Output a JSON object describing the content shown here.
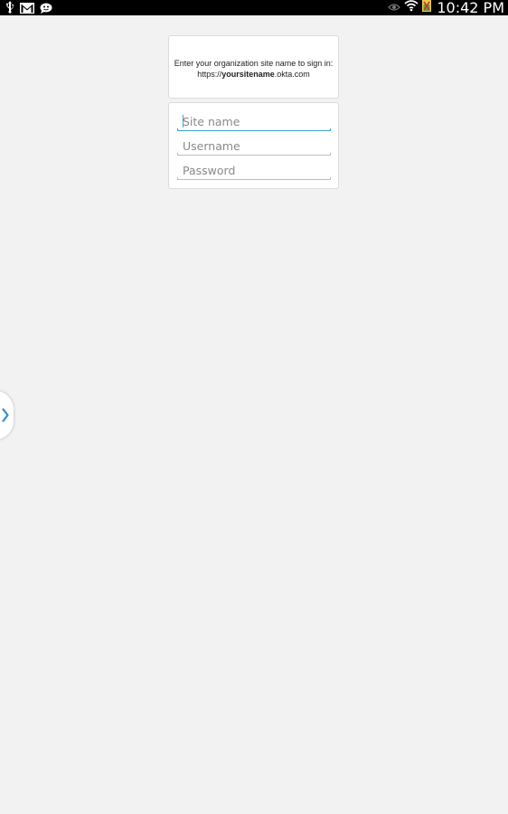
{
  "status_bar": {
    "time": "10:42 PM",
    "icons_left": [
      "usb-icon",
      "gmail-icon",
      "chat-icon"
    ],
    "icons_right": [
      "eye-icon",
      "wifi-icon",
      "battery-icon"
    ]
  },
  "info": {
    "line1": "Enter your organization site name to sign in:",
    "url_prefix": "https://",
    "url_bold": "yoursitename",
    "url_suffix": ".okta.com"
  },
  "form": {
    "site_name": {
      "placeholder": "Site name",
      "value": ""
    },
    "username": {
      "placeholder": "Username",
      "value": ""
    },
    "password": {
      "placeholder": "Password",
      "value": ""
    }
  },
  "colors": {
    "accent": "#3aa3d8",
    "background": "#f2f2f2",
    "status_bar": "#000000"
  }
}
